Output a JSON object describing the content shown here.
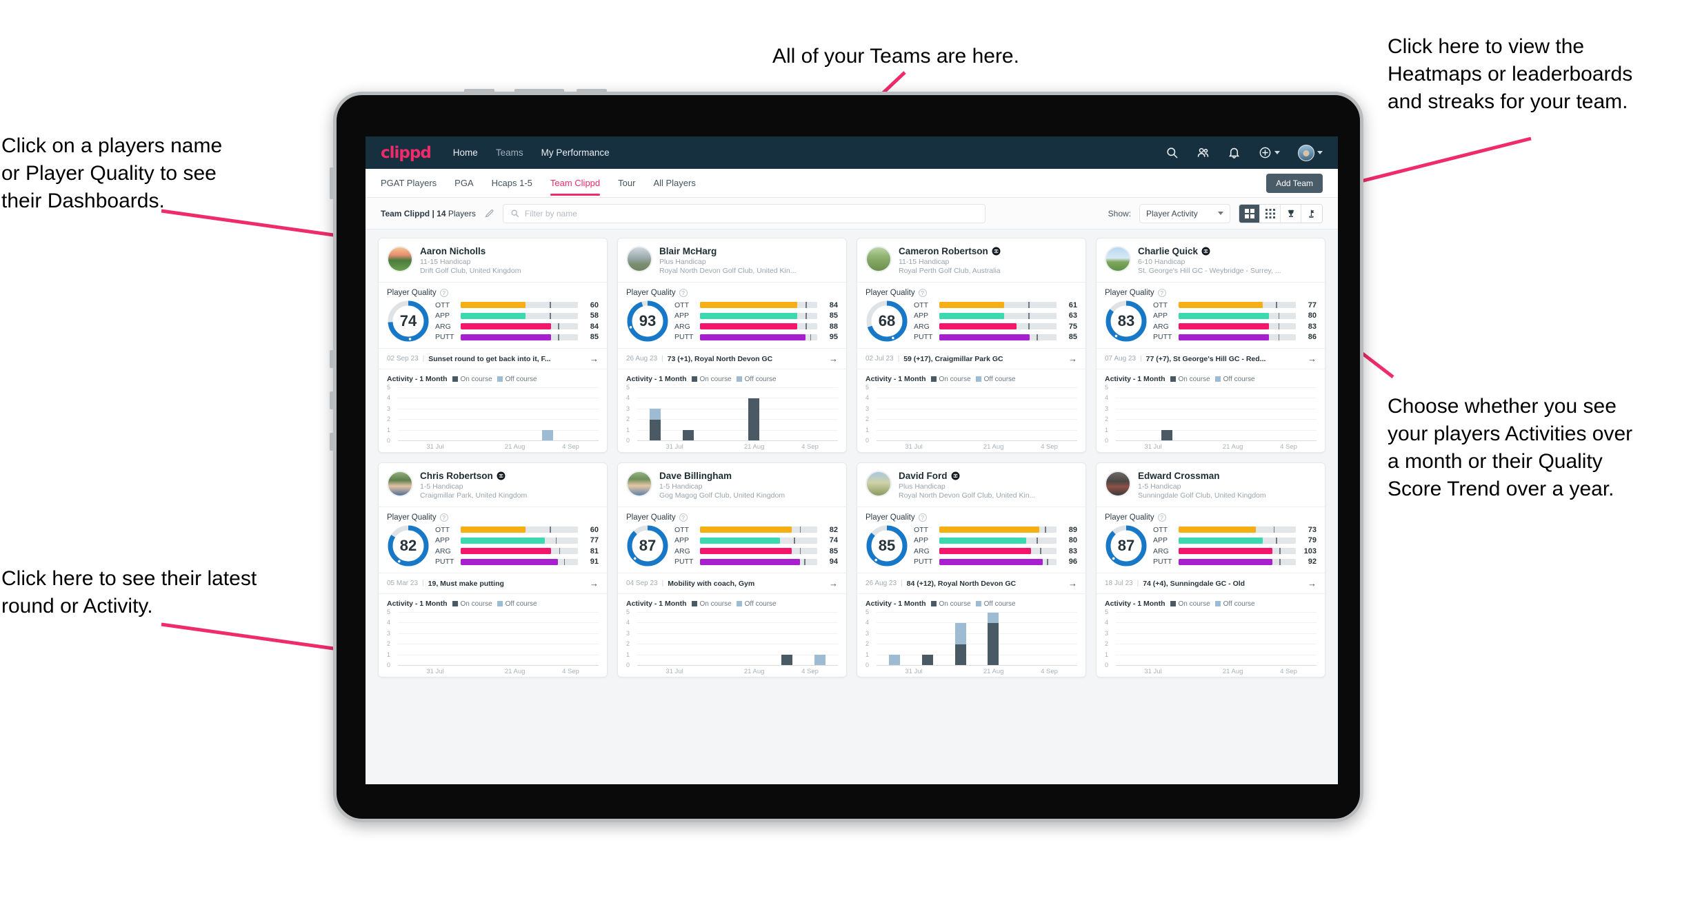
{
  "annotations": [
    {
      "id": "players-name",
      "text": "Click on a players name\nor Player Quality to see\ntheir Dashboards."
    },
    {
      "id": "teams",
      "text": "All of your Teams are here."
    },
    {
      "id": "heatmaps",
      "text": "Click here to view the\nHeatmaps or leaderboards\nand streaks for your team."
    },
    {
      "id": "show-toggle",
      "text": "Choose whether you see\nyour players Activities over\na month or their Quality\nScore Trend over a year."
    },
    {
      "id": "latest-round",
      "text": "Click here to see their latest\nround or Activity."
    }
  ],
  "colors": {
    "brand_pink": "#ef2b6a",
    "header_navy": "#17303f",
    "ring_blue": "#1878c8",
    "ott": "#f5ae14",
    "app": "#3ad9b0",
    "arg": "#f5156b",
    "putt": "#a81fd0",
    "on_course": "#4a5a65",
    "off_course": "#9dbbd2"
  },
  "header": {
    "brand": "clippd",
    "nav": [
      {
        "label": "Home",
        "active": true
      },
      {
        "label": "Teams",
        "active": false
      },
      {
        "label": "My Performance",
        "active": true
      }
    ],
    "icons": [
      "search-icon",
      "people-icon",
      "bell-icon",
      "plus-circle-icon",
      "avatar"
    ]
  },
  "tabs": [
    {
      "label": "PGAT Players",
      "active": false
    },
    {
      "label": "PGA",
      "active": false
    },
    {
      "label": "Hcaps 1-5",
      "active": false
    },
    {
      "label": "Team Clippd",
      "active": true
    },
    {
      "label": "Tour",
      "active": false
    },
    {
      "label": "All Players",
      "active": false
    }
  ],
  "add_team_label": "Add Team",
  "filterbar": {
    "team_label_bold": "Team Clippd | 14",
    "team_label_rest": " Players",
    "edit_icon": "pencil-icon",
    "search_placeholder": "Filter by name",
    "show_label": "Show:",
    "show_value": "Player Activity",
    "view_modes": [
      {
        "icon": "grid-large-icon",
        "active": true
      },
      {
        "icon": "grid-small-icon",
        "active": false
      },
      {
        "icon": "trophy-icon",
        "active": false
      },
      {
        "icon": "flag-icon",
        "active": false
      }
    ]
  },
  "chart_data": {
    "type": "bar",
    "title": "Activity - 1 Month",
    "legend": [
      "On course",
      "Off course"
    ],
    "ylim": [
      0,
      5
    ],
    "yticks": [
      0,
      1,
      2,
      3,
      4,
      5
    ],
    "xlabels": [
      "31 Jul",
      "21 Aug",
      "4 Sep"
    ],
    "grid": true,
    "stacked": true,
    "nbins": 6,
    "series_per_player": [
      {
        "player": "Aaron Nicholls",
        "on_course": [
          0,
          0,
          0,
          0,
          1,
          0
        ],
        "off_course": [
          0,
          0,
          0,
          0,
          0,
          0
        ],
        "note": "single off-course style bar at bin 5"
      },
      {
        "player": "Blair McHarg",
        "on_course": [
          2,
          1,
          0,
          4,
          0,
          0
        ],
        "off_course": [
          1,
          0,
          0,
          0,
          0,
          0
        ]
      },
      {
        "player": "Cameron Robertson",
        "on_course": [
          0,
          0,
          0,
          0,
          0,
          0
        ],
        "off_course": [
          0,
          0,
          0,
          0,
          0,
          0
        ]
      },
      {
        "player": "Charlie Quick",
        "on_course": [
          0,
          1,
          0,
          0,
          0,
          0
        ],
        "off_course": [
          0,
          0,
          0,
          0,
          0,
          0
        ]
      },
      {
        "player": "Chris Robertson",
        "on_course": [
          0,
          0,
          0,
          0,
          0,
          0
        ],
        "off_course": [
          0,
          0,
          0,
          0,
          0,
          0
        ]
      },
      {
        "player": "Dave Billingham",
        "on_course": [
          0,
          0,
          0,
          0,
          1,
          0
        ],
        "off_course": [
          0,
          0,
          0,
          0,
          0,
          1
        ]
      },
      {
        "player": "David Ford",
        "on_course": [
          0,
          1,
          2,
          4,
          0,
          0
        ],
        "off_course": [
          1,
          0,
          2,
          1,
          0,
          0
        ]
      },
      {
        "player": "Edward Crossman",
        "on_course": [
          0,
          0,
          0,
          0,
          0,
          0
        ],
        "off_course": [
          0,
          0,
          0,
          0,
          0,
          0
        ]
      }
    ]
  },
  "cards": [
    {
      "name": "Aaron Nicholls",
      "verified": false,
      "handicap": "11-15 Handicap",
      "club": "Drift Golf Club, United Kingdom",
      "quality_title": "Player Quality",
      "score": 74,
      "ring_pct": 74,
      "metrics": [
        {
          "label": "OTT",
          "value": 60,
          "fill": 55,
          "tick": 76
        },
        {
          "label": "APP",
          "value": 58,
          "fill": 55,
          "tick": 76
        },
        {
          "label": "ARG",
          "value": 84,
          "fill": 77,
          "tick": 83
        },
        {
          "label": "PUTT",
          "value": 85,
          "fill": 77,
          "tick": 83
        }
      ],
      "round": {
        "date": "02 Sep 23",
        "text": "Sunset round to get back into it, F..."
      },
      "activity_title": "Activity - 1 Month",
      "bars": [
        {
          "on": 0,
          "off": 0
        },
        {
          "on": 0,
          "off": 0
        },
        {
          "on": 0,
          "off": 0
        },
        {
          "on": 0,
          "off": 0
        },
        {
          "on": 0,
          "off": 1
        },
        {
          "on": 0,
          "off": 0
        }
      ],
      "avatar_style": "course-sunset"
    },
    {
      "name": "Blair McHarg",
      "verified": false,
      "handicap": "Plus Handicap",
      "club": "Royal North Devon Golf Club, United Kin...",
      "quality_title": "Player Quality",
      "score": 93,
      "ring_pct": 95,
      "metrics": [
        {
          "label": "OTT",
          "value": 84,
          "fill": 83,
          "tick": 90
        },
        {
          "label": "APP",
          "value": 85,
          "fill": 83,
          "tick": 90
        },
        {
          "label": "ARG",
          "value": 88,
          "fill": 83,
          "tick": 90
        },
        {
          "label": "PUTT",
          "value": 95,
          "fill": 90,
          "tick": 94
        }
      ],
      "round": {
        "date": "26 Aug 23",
        "text": "73 (+1), Royal North Devon GC"
      },
      "activity_title": "Activity - 1 Month",
      "bars": [
        {
          "on": 2,
          "off": 1
        },
        {
          "on": 1,
          "off": 0
        },
        {
          "on": 0,
          "off": 0
        },
        {
          "on": 4,
          "off": 0
        },
        {
          "on": 0,
          "off": 0
        },
        {
          "on": 0,
          "off": 0
        }
      ],
      "avatar_style": "course-links"
    },
    {
      "name": "Cameron Robertson",
      "verified": true,
      "handicap": "11-15 Handicap",
      "club": "Royal Perth Golf Club, Australia",
      "quality_title": "Player Quality",
      "score": 68,
      "ring_pct": 70,
      "metrics": [
        {
          "label": "OTT",
          "value": 61,
          "fill": 55,
          "tick": 76
        },
        {
          "label": "APP",
          "value": 63,
          "fill": 55,
          "tick": 76
        },
        {
          "label": "ARG",
          "value": 75,
          "fill": 66,
          "tick": 76
        },
        {
          "label": "PUTT",
          "value": 85,
          "fill": 77,
          "tick": 83
        }
      ],
      "round": {
        "date": "02 Jul 23",
        "text": "59 (+17), Craigmillar Park GC"
      },
      "activity_title": "Activity - 1 Month",
      "bars": [
        {
          "on": 0,
          "off": 0
        },
        {
          "on": 0,
          "off": 0
        },
        {
          "on": 0,
          "off": 0
        },
        {
          "on": 0,
          "off": 0
        },
        {
          "on": 0,
          "off": 0
        },
        {
          "on": 0,
          "off": 0
        }
      ],
      "avatar_style": "course-tree"
    },
    {
      "name": "Charlie Quick",
      "verified": true,
      "handicap": "6-10 Handicap",
      "club": "St. George's Hill GC - Weybridge - Surrey, ...",
      "quality_title": "Player Quality",
      "score": 83,
      "ring_pct": 85,
      "metrics": [
        {
          "label": "OTT",
          "value": 77,
          "fill": 72,
          "tick": 83
        },
        {
          "label": "APP",
          "value": 80,
          "fill": 77,
          "tick": 85
        },
        {
          "label": "ARG",
          "value": 83,
          "fill": 77,
          "tick": 85
        },
        {
          "label": "PUTT",
          "value": 86,
          "fill": 77,
          "tick": 85
        }
      ],
      "round": {
        "date": "07 Aug 23",
        "text": "77 (+7), St George's Hill GC - Red..."
      },
      "activity_title": "Activity - 1 Month",
      "bars": [
        {
          "on": 0,
          "off": 0
        },
        {
          "on": 1,
          "off": 0
        },
        {
          "on": 0,
          "off": 0
        },
        {
          "on": 0,
          "off": 0
        },
        {
          "on": 0,
          "off": 0
        },
        {
          "on": 0,
          "off": 0
        }
      ],
      "avatar_style": "course-sky"
    },
    {
      "name": "Chris Robertson",
      "verified": true,
      "handicap": "1-5 Handicap",
      "club": "Craigmillar Park, United Kingdom",
      "quality_title": "Player Quality",
      "score": 82,
      "ring_pct": 84,
      "metrics": [
        {
          "label": "OTT",
          "value": 60,
          "fill": 55,
          "tick": 76
        },
        {
          "label": "APP",
          "value": 77,
          "fill": 72,
          "tick": 81
        },
        {
          "label": "ARG",
          "value": 81,
          "fill": 77,
          "tick": 84
        },
        {
          "label": "PUTT",
          "value": 91,
          "fill": 83,
          "tick": 88
        }
      ],
      "round": {
        "date": "05 Mar 23",
        "text": "19, Must make putting"
      },
      "activity_title": "Activity - 1 Month",
      "bars": [
        {
          "on": 0,
          "off": 0
        },
        {
          "on": 0,
          "off": 0
        },
        {
          "on": 0,
          "off": 0
        },
        {
          "on": 0,
          "off": 0
        },
        {
          "on": 0,
          "off": 0
        },
        {
          "on": 0,
          "off": 0
        }
      ],
      "avatar_style": "person-a"
    },
    {
      "name": "Dave Billingham",
      "verified": false,
      "handicap": "1-5 Handicap",
      "club": "Gog Magog Golf Club, United Kingdom",
      "quality_title": "Player Quality",
      "score": 87,
      "ring_pct": 88,
      "metrics": [
        {
          "label": "OTT",
          "value": 82,
          "fill": 78,
          "tick": 85
        },
        {
          "label": "APP",
          "value": 74,
          "fill": 68,
          "tick": 80
        },
        {
          "label": "ARG",
          "value": 85,
          "fill": 78,
          "tick": 85
        },
        {
          "label": "PUTT",
          "value": 94,
          "fill": 85,
          "tick": 89
        }
      ],
      "round": {
        "date": "04 Sep 23",
        "text": "Mobility with coach, Gym"
      },
      "activity_title": "Activity - 1 Month",
      "bars": [
        {
          "on": 0,
          "off": 0
        },
        {
          "on": 0,
          "off": 0
        },
        {
          "on": 0,
          "off": 0
        },
        {
          "on": 0,
          "off": 0
        },
        {
          "on": 1,
          "off": 0
        },
        {
          "on": 0,
          "off": 1
        }
      ],
      "avatar_style": "person-b"
    },
    {
      "name": "David Ford",
      "verified": true,
      "handicap": "Plus Handicap",
      "club": "Royal North Devon Golf Club, United Kin...",
      "quality_title": "Player Quality",
      "score": 85,
      "ring_pct": 86,
      "metrics": [
        {
          "label": "OTT",
          "value": 89,
          "fill": 85,
          "tick": 90
        },
        {
          "label": "APP",
          "value": 80,
          "fill": 74,
          "tick": 83
        },
        {
          "label": "ARG",
          "value": 83,
          "fill": 78,
          "tick": 86
        },
        {
          "label": "PUTT",
          "value": 96,
          "fill": 88,
          "tick": 92
        }
      ],
      "round": {
        "date": "26 Aug 23",
        "text": "84 (+12), Royal North Devon GC"
      },
      "activity_title": "Activity - 1 Month",
      "bars": [
        {
          "on": 0,
          "off": 1
        },
        {
          "on": 1,
          "off": 0
        },
        {
          "on": 2,
          "off": 2
        },
        {
          "on": 4,
          "off": 1
        },
        {
          "on": 0,
          "off": 0
        },
        {
          "on": 0,
          "off": 0
        }
      ],
      "avatar_style": "course-dune"
    },
    {
      "name": "Edward Crossman",
      "verified": false,
      "handicap": "1-5 Handicap",
      "club": "Sunningdale Golf Club, United Kingdom",
      "quality_title": "Player Quality",
      "score": 87,
      "ring_pct": 88,
      "metrics": [
        {
          "label": "OTT",
          "value": 73,
          "fill": 66,
          "tick": 81
        },
        {
          "label": "APP",
          "value": 79,
          "fill": 72,
          "tick": 83
        },
        {
          "label": "ARG",
          "value": 103,
          "fill": 80,
          "tick": 86
        },
        {
          "label": "PUTT",
          "value": 92,
          "fill": 80,
          "tick": 86
        }
      ],
      "round": {
        "date": "18 Jul 23",
        "text": "74 (+4), Sunningdale GC - Old"
      },
      "activity_title": "Activity - 1 Month",
      "bars": [
        {
          "on": 0,
          "off": 0
        },
        {
          "on": 0,
          "off": 0
        },
        {
          "on": 0,
          "off": 0
        },
        {
          "on": 0,
          "off": 0
        },
        {
          "on": 0,
          "off": 0
        },
        {
          "on": 0,
          "off": 0
        }
      ],
      "avatar_style": "person-c"
    }
  ],
  "chart_axes": {
    "yticks": [
      "5",
      "4",
      "3",
      "2",
      "1",
      "0"
    ],
    "xlabels": [
      "31 Jul",
      "21 Aug",
      "4 Sep"
    ],
    "legend_on": "On course",
    "legend_off": "Off course"
  }
}
